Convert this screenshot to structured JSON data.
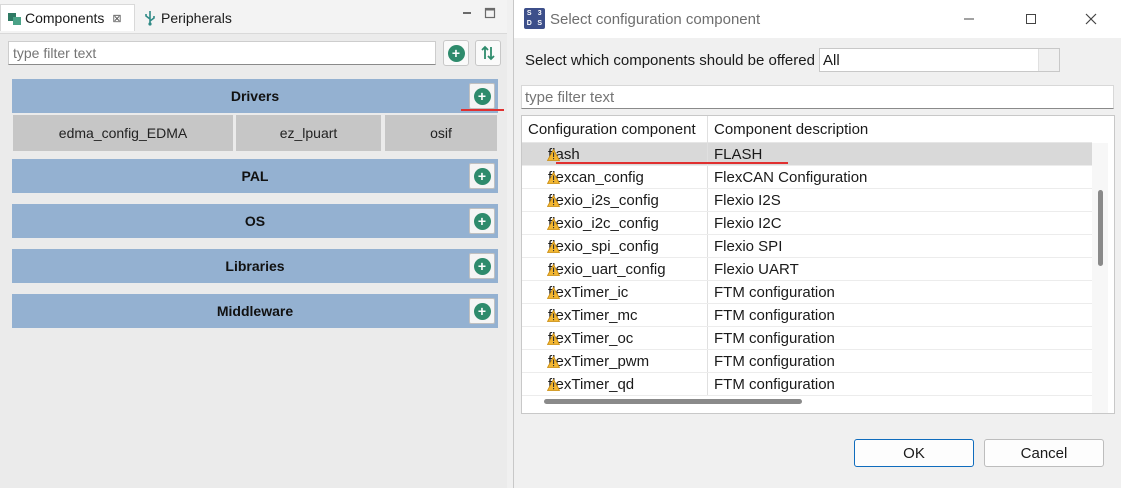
{
  "left_panel": {
    "tabs": [
      {
        "label": "Components",
        "close": "⊠"
      },
      {
        "label": "Peripherals"
      }
    ],
    "filter_placeholder": "type filter text",
    "groups": {
      "drivers": {
        "label": "Drivers",
        "components": [
          "edma_config_EDMA",
          "ez_lpuart",
          "osif"
        ]
      },
      "pal": {
        "label": "PAL"
      },
      "os": {
        "label": "OS"
      },
      "libraries": {
        "label": "Libraries"
      },
      "middleware": {
        "label": "Middleware"
      }
    }
  },
  "dialog": {
    "title": "Select configuration component",
    "offer_label": "Select which components should be offered",
    "offer_value": "All",
    "filter_placeholder": "type filter text",
    "columns": [
      "Configuration component",
      "Component description"
    ],
    "rows": [
      {
        "name": "flash",
        "desc": "FLASH"
      },
      {
        "name": "flexcan_config",
        "desc": "FlexCAN Configuration"
      },
      {
        "name": "flexio_i2s_config",
        "desc": "Flexio I2S"
      },
      {
        "name": "flexio_i2c_config",
        "desc": "Flexio I2C"
      },
      {
        "name": "flexio_spi_config",
        "desc": "Flexio SPI"
      },
      {
        "name": "flexio_uart_config",
        "desc": "Flexio UART"
      },
      {
        "name": "flexTimer_ic",
        "desc": "FTM configuration"
      },
      {
        "name": "flexTimer_mc",
        "desc": "FTM configuration"
      },
      {
        "name": "flexTimer_oc",
        "desc": "FTM configuration"
      },
      {
        "name": "flexTimer_pwm",
        "desc": "FTM configuration"
      },
      {
        "name": "flexTimer_qd",
        "desc": "FTM configuration"
      }
    ],
    "ok_label": "OK",
    "cancel_label": "Cancel"
  },
  "colors": {
    "group_header": "#94b1d1",
    "component_tile": "#c6c6c6",
    "accent_green": "#2e8b6c",
    "annotation_red": "#e03030",
    "selected_row": "#d9d9d9"
  }
}
